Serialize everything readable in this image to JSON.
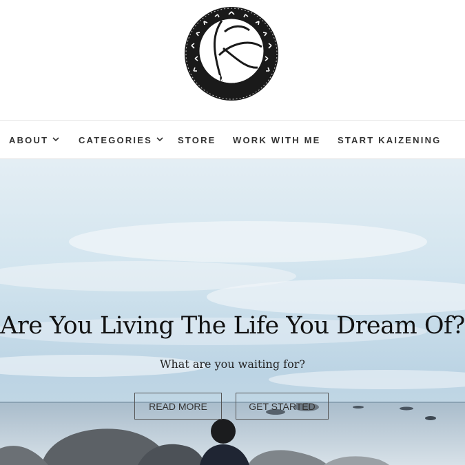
{
  "brand": {
    "logo_text": "KAIZENING",
    "logo_icon": "kaizening-emblem"
  },
  "nav": {
    "items": [
      {
        "label": "ABOUT",
        "has_dropdown": true
      },
      {
        "label": "CATEGORIES",
        "has_dropdown": true
      },
      {
        "label": "STORE",
        "has_dropdown": false
      },
      {
        "label": "WORK WITH ME",
        "has_dropdown": false
      },
      {
        "label": "START KAIZENING",
        "has_dropdown": false
      }
    ]
  },
  "hero": {
    "title": "Are You Living The Life You Dream Of?",
    "subtitle": "What are you waiting for?",
    "read_more_label": "READ MORE",
    "get_started_label": "GET STARTED"
  },
  "colors": {
    "text": "#333333",
    "sky": "#cfe3ef",
    "sea": "#8fa7b8"
  }
}
